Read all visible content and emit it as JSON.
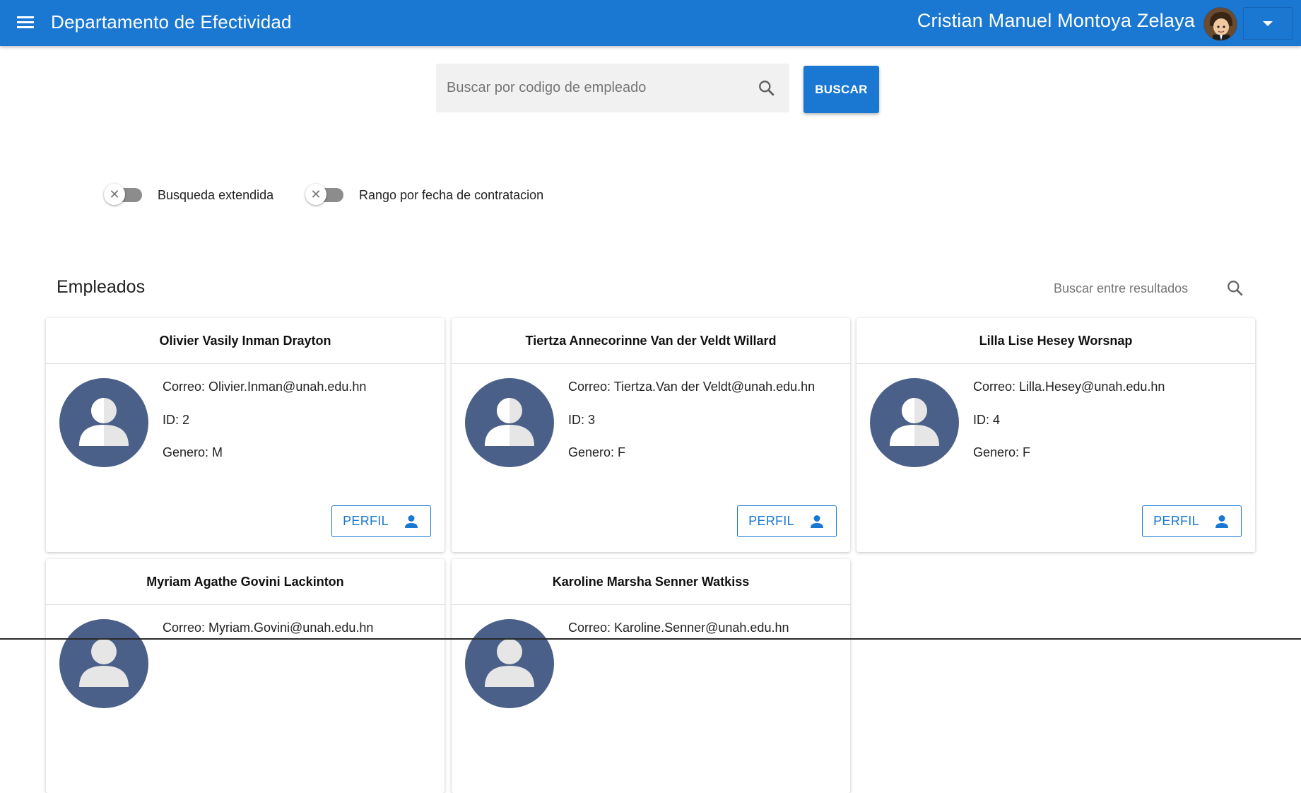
{
  "appbar": {
    "title": "Departamento de Efectividad",
    "user_name": "Cristian Manuel Montoya Zelaya"
  },
  "search": {
    "placeholder": "Buscar por codigo de empleado",
    "button_label": "BUSCAR"
  },
  "toggles": [
    {
      "label": "Busqueda extendida",
      "enabled": false
    },
    {
      "label": "Rango por fecha de contratacion",
      "enabled": false
    }
  ],
  "results": {
    "title": "Empleados",
    "search_placeholder": "Buscar entre resultados"
  },
  "employees": [
    {
      "name": "Olivier Vasily Inman Drayton",
      "email": "Correo: Olivier.Inman@unah.edu.hn",
      "id": "ID: 2",
      "gender": "Genero: M",
      "button": "PERFIL"
    },
    {
      "name": "Tiertza Annecorinne Van der Veldt Willard",
      "email": "Correo: Tiertza.Van der Veldt@unah.edu.hn",
      "id": "ID: 3",
      "gender": "Genero: F",
      "button": "PERFIL"
    },
    {
      "name": "Lilla Lise Hesey Worsnap",
      "email": "Correo: Lilla.Hesey@unah.edu.hn",
      "id": "ID: 4",
      "gender": "Genero: F",
      "button": "PERFIL"
    },
    {
      "name": "Myriam Agathe Govini Lackinton",
      "email": "Correo: Myriam.Govini@unah.edu.hn"
    },
    {
      "name": "Karoline Marsha Senner Watkiss",
      "email": "Correo: Karoline.Senner@unah.edu.hn"
    }
  ],
  "colors": {
    "primary": "#1a78d2",
    "avatar_bg": "#4a6088"
  },
  "icons": [
    "menu-icon",
    "user-avatar",
    "caret-down-icon",
    "search-icon",
    "person-icon",
    "close-icon"
  ]
}
